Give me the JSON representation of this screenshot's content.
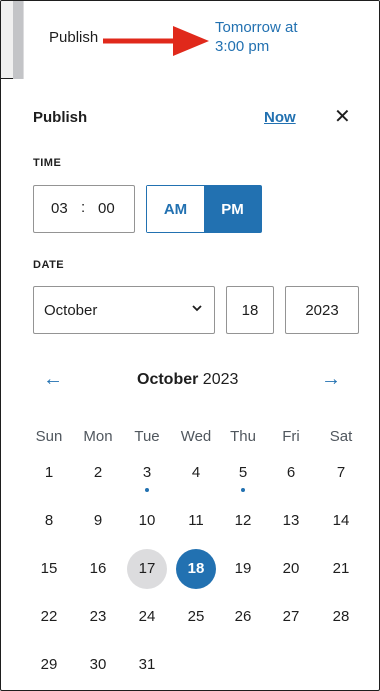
{
  "top": {
    "publish_label": "Publish",
    "schedule_line1": "Tomorrow at",
    "schedule_line2": "3:00 pm"
  },
  "panel": {
    "title": "Publish",
    "now_label": "Now",
    "close_glyph": "✕"
  },
  "time": {
    "label": "TIME",
    "hours": "03",
    "separator": ":",
    "minutes": "00",
    "am_label": "AM",
    "pm_label": "PM",
    "selected": "PM"
  },
  "date": {
    "label": "DATE",
    "month": "October",
    "day": "18",
    "year": "2023"
  },
  "calendar": {
    "prev_glyph": "←",
    "next_glyph": "→",
    "month_name": "October",
    "year": "2023",
    "weekdays": [
      "Sun",
      "Mon",
      "Tue",
      "Wed",
      "Thu",
      "Fri",
      "Sat"
    ],
    "weeks": [
      [
        "1",
        "2",
        "3",
        "4",
        "5",
        "6",
        "7"
      ],
      [
        "8",
        "9",
        "10",
        "11",
        "12",
        "13",
        "14"
      ],
      [
        "15",
        "16",
        "17",
        "18",
        "19",
        "20",
        "21"
      ],
      [
        "22",
        "23",
        "24",
        "25",
        "26",
        "27",
        "28"
      ],
      [
        "29",
        "30",
        "31"
      ]
    ],
    "today": "17",
    "selected": "18",
    "days_with_posts": [
      "3",
      "5"
    ]
  },
  "colors": {
    "accent": "#2271b1",
    "annotation_arrow": "#e0291b"
  },
  "icons": {
    "arrow": "annotation-arrow-icon",
    "close": "close-icon",
    "prev": "arrow-left-icon",
    "next": "arrow-right-icon",
    "chevron": "chevron-down-icon"
  }
}
